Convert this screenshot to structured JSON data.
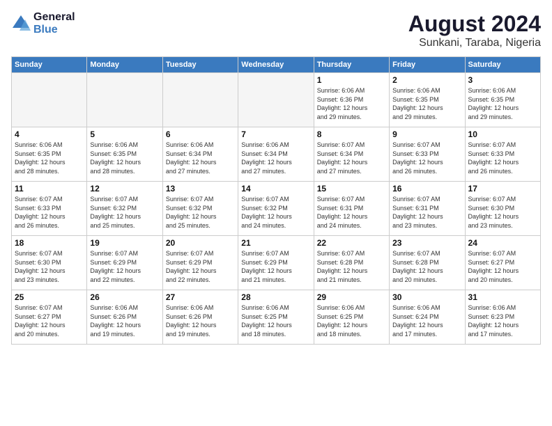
{
  "header": {
    "logo_line1": "General",
    "logo_line2": "Blue",
    "month_year": "August 2024",
    "location": "Sunkani, Taraba, Nigeria"
  },
  "weekdays": [
    "Sunday",
    "Monday",
    "Tuesday",
    "Wednesday",
    "Thursday",
    "Friday",
    "Saturday"
  ],
  "weeks": [
    [
      {
        "day": "",
        "info": ""
      },
      {
        "day": "",
        "info": ""
      },
      {
        "day": "",
        "info": ""
      },
      {
        "day": "",
        "info": ""
      },
      {
        "day": "1",
        "info": "Sunrise: 6:06 AM\nSunset: 6:36 PM\nDaylight: 12 hours\nand 29 minutes."
      },
      {
        "day": "2",
        "info": "Sunrise: 6:06 AM\nSunset: 6:35 PM\nDaylight: 12 hours\nand 29 minutes."
      },
      {
        "day": "3",
        "info": "Sunrise: 6:06 AM\nSunset: 6:35 PM\nDaylight: 12 hours\nand 29 minutes."
      }
    ],
    [
      {
        "day": "4",
        "info": "Sunrise: 6:06 AM\nSunset: 6:35 PM\nDaylight: 12 hours\nand 28 minutes."
      },
      {
        "day": "5",
        "info": "Sunrise: 6:06 AM\nSunset: 6:35 PM\nDaylight: 12 hours\nand 28 minutes."
      },
      {
        "day": "6",
        "info": "Sunrise: 6:06 AM\nSunset: 6:34 PM\nDaylight: 12 hours\nand 27 minutes."
      },
      {
        "day": "7",
        "info": "Sunrise: 6:06 AM\nSunset: 6:34 PM\nDaylight: 12 hours\nand 27 minutes."
      },
      {
        "day": "8",
        "info": "Sunrise: 6:07 AM\nSunset: 6:34 PM\nDaylight: 12 hours\nand 27 minutes."
      },
      {
        "day": "9",
        "info": "Sunrise: 6:07 AM\nSunset: 6:33 PM\nDaylight: 12 hours\nand 26 minutes."
      },
      {
        "day": "10",
        "info": "Sunrise: 6:07 AM\nSunset: 6:33 PM\nDaylight: 12 hours\nand 26 minutes."
      }
    ],
    [
      {
        "day": "11",
        "info": "Sunrise: 6:07 AM\nSunset: 6:33 PM\nDaylight: 12 hours\nand 26 minutes."
      },
      {
        "day": "12",
        "info": "Sunrise: 6:07 AM\nSunset: 6:32 PM\nDaylight: 12 hours\nand 25 minutes."
      },
      {
        "day": "13",
        "info": "Sunrise: 6:07 AM\nSunset: 6:32 PM\nDaylight: 12 hours\nand 25 minutes."
      },
      {
        "day": "14",
        "info": "Sunrise: 6:07 AM\nSunset: 6:32 PM\nDaylight: 12 hours\nand 24 minutes."
      },
      {
        "day": "15",
        "info": "Sunrise: 6:07 AM\nSunset: 6:31 PM\nDaylight: 12 hours\nand 24 minutes."
      },
      {
        "day": "16",
        "info": "Sunrise: 6:07 AM\nSunset: 6:31 PM\nDaylight: 12 hours\nand 23 minutes."
      },
      {
        "day": "17",
        "info": "Sunrise: 6:07 AM\nSunset: 6:30 PM\nDaylight: 12 hours\nand 23 minutes."
      }
    ],
    [
      {
        "day": "18",
        "info": "Sunrise: 6:07 AM\nSunset: 6:30 PM\nDaylight: 12 hours\nand 23 minutes."
      },
      {
        "day": "19",
        "info": "Sunrise: 6:07 AM\nSunset: 6:29 PM\nDaylight: 12 hours\nand 22 minutes."
      },
      {
        "day": "20",
        "info": "Sunrise: 6:07 AM\nSunset: 6:29 PM\nDaylight: 12 hours\nand 22 minutes."
      },
      {
        "day": "21",
        "info": "Sunrise: 6:07 AM\nSunset: 6:29 PM\nDaylight: 12 hours\nand 21 minutes."
      },
      {
        "day": "22",
        "info": "Sunrise: 6:07 AM\nSunset: 6:28 PM\nDaylight: 12 hours\nand 21 minutes."
      },
      {
        "day": "23",
        "info": "Sunrise: 6:07 AM\nSunset: 6:28 PM\nDaylight: 12 hours\nand 20 minutes."
      },
      {
        "day": "24",
        "info": "Sunrise: 6:07 AM\nSunset: 6:27 PM\nDaylight: 12 hours\nand 20 minutes."
      }
    ],
    [
      {
        "day": "25",
        "info": "Sunrise: 6:07 AM\nSunset: 6:27 PM\nDaylight: 12 hours\nand 20 minutes."
      },
      {
        "day": "26",
        "info": "Sunrise: 6:06 AM\nSunset: 6:26 PM\nDaylight: 12 hours\nand 19 minutes."
      },
      {
        "day": "27",
        "info": "Sunrise: 6:06 AM\nSunset: 6:26 PM\nDaylight: 12 hours\nand 19 minutes."
      },
      {
        "day": "28",
        "info": "Sunrise: 6:06 AM\nSunset: 6:25 PM\nDaylight: 12 hours\nand 18 minutes."
      },
      {
        "day": "29",
        "info": "Sunrise: 6:06 AM\nSunset: 6:25 PM\nDaylight: 12 hours\nand 18 minutes."
      },
      {
        "day": "30",
        "info": "Sunrise: 6:06 AM\nSunset: 6:24 PM\nDaylight: 12 hours\nand 17 minutes."
      },
      {
        "day": "31",
        "info": "Sunrise: 6:06 AM\nSunset: 6:23 PM\nDaylight: 12 hours\nand 17 minutes."
      }
    ]
  ]
}
